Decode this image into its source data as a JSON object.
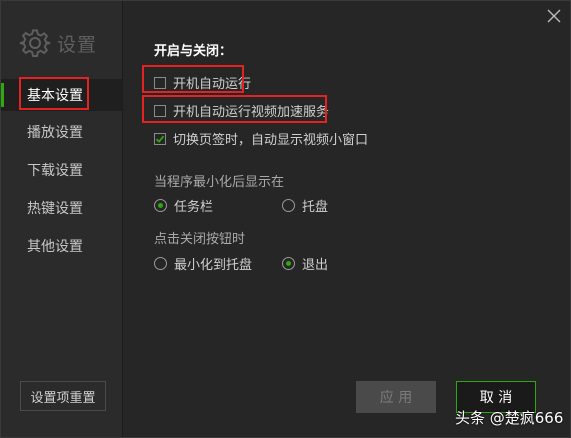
{
  "window": {
    "title": "设置"
  },
  "sidebar": {
    "items": [
      {
        "label": "基本设置",
        "active": true
      },
      {
        "label": "播放设置"
      },
      {
        "label": "下载设置"
      },
      {
        "label": "热键设置"
      },
      {
        "label": "其他设置"
      }
    ],
    "reset_label": "设置项重置"
  },
  "main": {
    "section_title": "开启与关闭：",
    "checkboxes": [
      {
        "label": "开机自动运行",
        "checked": false
      },
      {
        "label": "开机自动运行视频加速服务",
        "checked": false
      },
      {
        "label": "切换页签时，自动显示视频小窗口",
        "checked": true
      }
    ],
    "minimize_group": {
      "label": "当程序最小化后显示在",
      "options": [
        {
          "label": "任务栏",
          "selected": true
        },
        {
          "label": "托盘",
          "selected": false
        }
      ]
    },
    "close_group": {
      "label": "点击关闭按钮时",
      "options": [
        {
          "label": "最小化到托盘",
          "selected": false
        },
        {
          "label": "退出",
          "selected": true
        }
      ]
    }
  },
  "footer": {
    "apply_label": "应 用",
    "cancel_label": "取 消"
  },
  "watermark": "头条 @楚疯666",
  "colors": {
    "accent": "#2ea80f",
    "highlight_box": "#e32222"
  }
}
